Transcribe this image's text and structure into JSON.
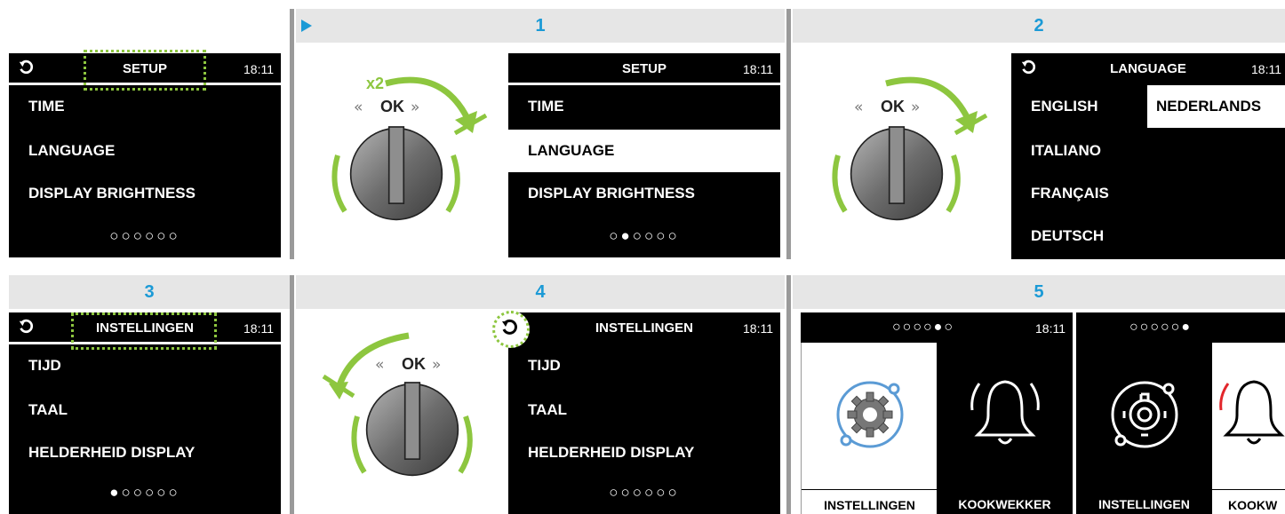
{
  "clock": "18:11",
  "steps": [
    "1",
    "2",
    "3",
    "4",
    "5"
  ],
  "ok_label": "OK",
  "x2_label": "x2",
  "panel0": {
    "title": "SETUP",
    "items": [
      "TIME",
      "LANGUAGE",
      "DISPLAY BRIGHTNESS"
    ],
    "dots": "○○○○○○"
  },
  "panel1": {
    "title": "SETUP",
    "items": [
      "TIME",
      "LANGUAGE",
      "DISPLAY BRIGHTNESS"
    ],
    "selected": "LANGUAGE",
    "dots": "○●○○○○"
  },
  "panel2": {
    "title": "LANGUAGE",
    "items": [
      "ENGLISH",
      "ITALIANO",
      "FRANÇAIS",
      "DEUTSCH"
    ],
    "selected": "NEDERLANDS"
  },
  "panel3": {
    "title": "INSTELLINGEN",
    "items": [
      "TIJD",
      "TAAL",
      "HELDERHEID DISPLAY"
    ],
    "dots": "●○○○○○"
  },
  "panel4": {
    "title": "INSTELLINGEN",
    "items": [
      "TIJD",
      "TAAL",
      "HELDERHEID DISPLAY"
    ],
    "dots": "○○○○○○"
  },
  "panel5": {
    "dots_a": "○○○○●○",
    "dots_b": "○○○○○●",
    "tiles": [
      "INSTELLINGEN",
      "KOOKWEKKER",
      "INSTELLINGEN",
      "KOOKW"
    ]
  },
  "colors": {
    "accent_green": "#8dc63f",
    "step_blue": "#1b9ad6",
    "header_gray": "#e6e6e6",
    "alarm_red": "#e2262b"
  },
  "icons": [
    "back-arrow-icon",
    "play-triangle-icon",
    "knob-icon",
    "gear-icon",
    "bell-icon"
  ]
}
